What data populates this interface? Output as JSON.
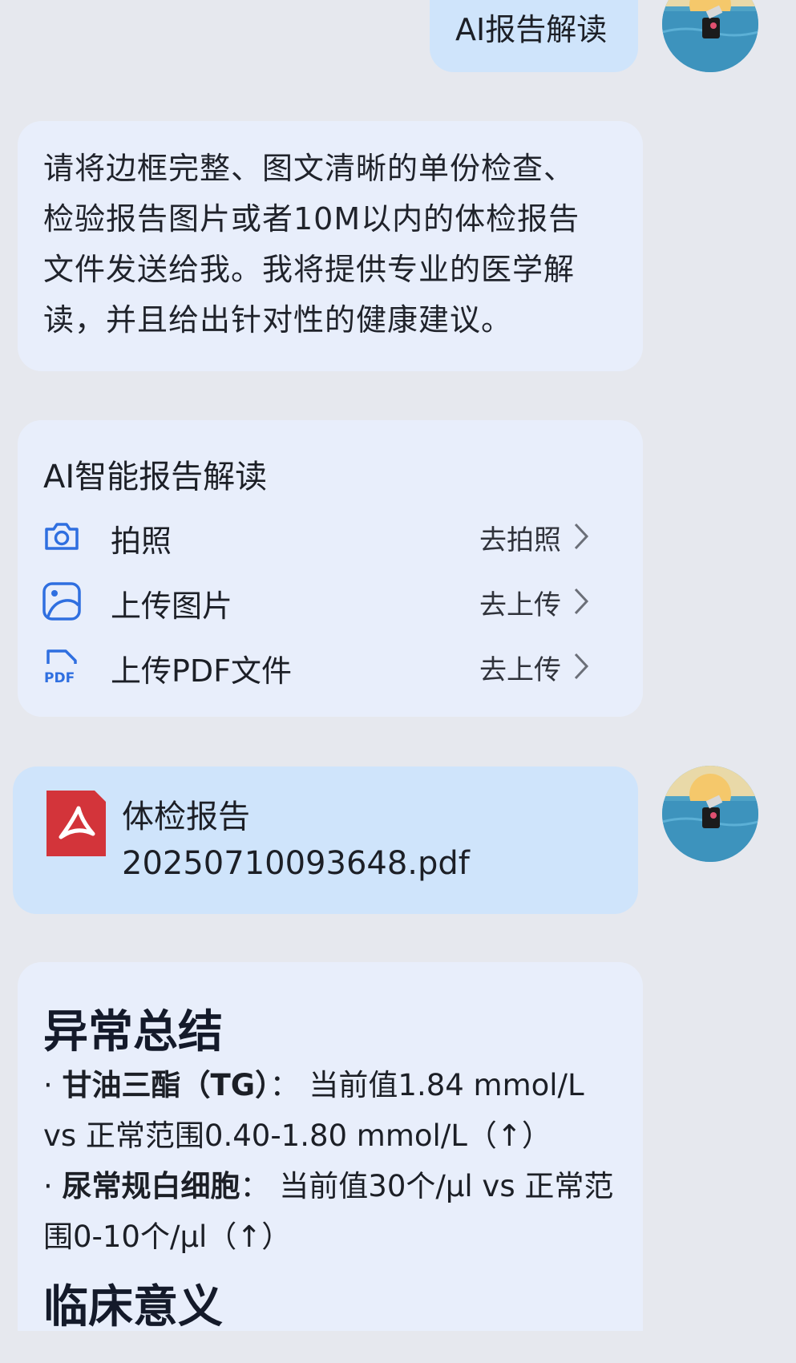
{
  "user_message": {
    "text": "AI报告解读"
  },
  "intro_message": {
    "text": "请将边框完整、图文清晰的单份检查、检验报告图片或者10M以内的体检报告文件发送给我。我将提供专业的医学解读，并且给出针对性的健康建议。"
  },
  "report_card": {
    "title": "AI智能报告解读",
    "options": [
      {
        "icon": "camera-icon",
        "label": "拍照",
        "action": "去拍照"
      },
      {
        "icon": "image-upload-icon",
        "label": "上传图片",
        "action": "去上传"
      },
      {
        "icon": "pdf-icon",
        "label": "上传PDF文件",
        "action": "去上传"
      }
    ]
  },
  "file_message": {
    "icon": "pdf-file-icon",
    "name_line1": "体检报告",
    "name_line2": "20250710093648.pdf"
  },
  "analysis": {
    "heading1": "异常总结",
    "items": [
      {
        "bullet": "·",
        "term": "甘油三酯（TG）",
        "sep": "：",
        "text": "当前值1.84 mmol/L vs 正常范围0.40-1.80 mmol/L（↑）"
      },
      {
        "bullet": "·",
        "term": "尿常规白细胞",
        "sep": "：",
        "text": "当前值30个/μl vs 正常范围0-10个/μl（↑）"
      }
    ],
    "heading2": "临床意义"
  },
  "colors": {
    "user_bubble": "#cfe4fb",
    "ai_bubble": "#e8eefb",
    "accent": "#2f6fe0",
    "pdf_red": "#d3343a"
  }
}
